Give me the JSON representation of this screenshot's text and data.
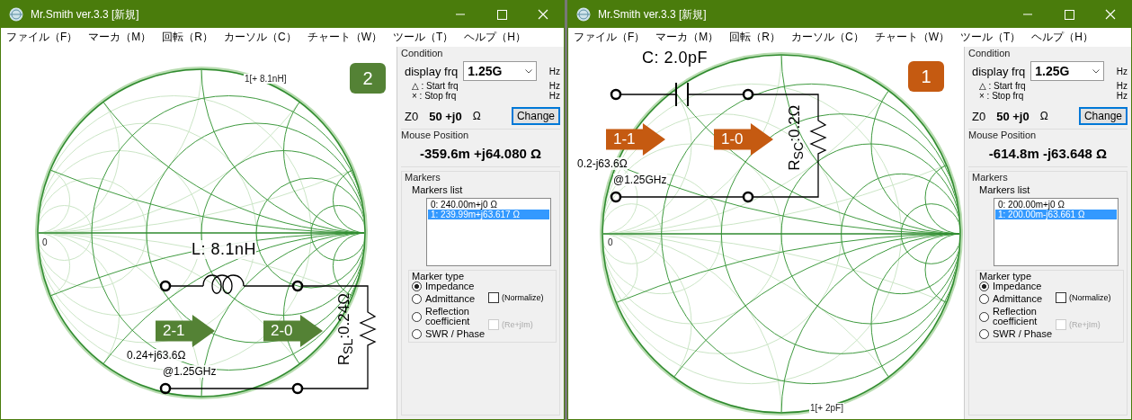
{
  "windows": [
    {
      "title": "Mr.Smith ver.3.3 [新規]",
      "menu": [
        "ファイル（F）",
        "マーカ（M）",
        "回転（R）",
        "カーソル（C）",
        "チャート（W）",
        "ツール（T）",
        "ヘルプ（H）"
      ],
      "chart": {
        "badge": {
          "text": "2",
          "color": "#548235"
        },
        "marker_label": "1[+ 8.1nH]",
        "origin_label": "0",
        "circuit": {
          "kind": "inductor",
          "component_label": "L: 8.1nH",
          "resistor_label": "R$_{SL}$:0.24Ω",
          "arrows": [
            {
              "text": "2-1",
              "color": "#548235"
            },
            {
              "text": "2-0",
              "color": "#548235"
            }
          ],
          "impedance": "0.24+j63.6Ω",
          "frequency": "@1.25GHz"
        }
      },
      "panel": {
        "condition_title": "Condition",
        "display_frq_label": "display frq",
        "display_frq_value": "1.25G",
        "display_frq_unit": "Hz",
        "start_label": "△ : Start frq",
        "start_unit": "Hz",
        "stop_label": "× : Stop frq",
        "stop_unit": "Hz",
        "z0_label": "Z0",
        "z0_value": "50 +j0",
        "z0_unit": "Ω",
        "change_button": "Change",
        "mouse_title": "Mouse Position",
        "mouse_value": "-359.6m +j64.080 Ω",
        "markers_title": "Markers",
        "markers_list_label": "Markers list",
        "markers": [
          {
            "text": "0: 240.00m+j0 Ω",
            "selected": false
          },
          {
            "text": "1: 239.99m+j63.617 Ω",
            "selected": true
          }
        ],
        "marker_type_title": "Marker type",
        "marker_types": [
          {
            "label": "Impedance",
            "selected": true
          },
          {
            "label": "Admittance",
            "selected": false
          },
          {
            "label": "Reflection\ncoefficient",
            "selected": false
          },
          {
            "label": "SWR / Phase",
            "selected": false
          }
        ],
        "options": [
          {
            "label": "(Normalize)",
            "checked": false,
            "disabled": false
          },
          {
            "label": "(Re+jIm)",
            "checked": false,
            "disabled": true
          }
        ]
      }
    },
    {
      "title": "Mr.Smith ver.3.3 [新規]",
      "menu": [
        "ファイル（F）",
        "マーカ（M）",
        "回転（R）",
        "カーソル（C）",
        "チャート（W）",
        "ツール（T）",
        "ヘルプ（H）"
      ],
      "chart": {
        "badge": {
          "text": "1",
          "color": "#c55a11"
        },
        "marker_label": "1[+ 2pF]",
        "origin_label": "0",
        "circuit": {
          "kind": "capacitor",
          "component_label": "C: 2.0pF",
          "resistor_label": "R$_{SC}$:0.2Ω",
          "arrows": [
            {
              "text": "1-1",
              "color": "#c55a11"
            },
            {
              "text": "1-0",
              "color": "#c55a11"
            }
          ],
          "impedance": "0.2-j63.6Ω",
          "frequency": "@1.25GHz"
        }
      },
      "panel": {
        "condition_title": "Condition",
        "display_frq_label": "display frq",
        "display_frq_value": "1.25G",
        "display_frq_unit": "Hz",
        "start_label": "△ : Start frq",
        "start_unit": "Hz",
        "stop_label": "× : Stop frq",
        "stop_unit": "Hz",
        "z0_label": "Z0",
        "z0_value": "50 +j0",
        "z0_unit": "Ω",
        "change_button": "Change",
        "mouse_title": "Mouse Position",
        "mouse_value": "-614.8m -j63.648 Ω",
        "markers_title": "Markers",
        "markers_list_label": "Markers list",
        "markers": [
          {
            "text": "0: 200.00m+j0 Ω",
            "selected": false
          },
          {
            "text": "1: 200.00m-j63.661 Ω",
            "selected": true
          }
        ],
        "marker_type_title": "Marker type",
        "marker_types": [
          {
            "label": "Impedance",
            "selected": true
          },
          {
            "label": "Admittance",
            "selected": false
          },
          {
            "label": "Reflection\ncoefficient",
            "selected": false
          },
          {
            "label": "SWR / Phase",
            "selected": false
          }
        ],
        "options": [
          {
            "label": "(Normalize)",
            "checked": false,
            "disabled": false
          },
          {
            "label": "(Re+jIm)",
            "checked": false,
            "disabled": true
          }
        ]
      }
    }
  ]
}
